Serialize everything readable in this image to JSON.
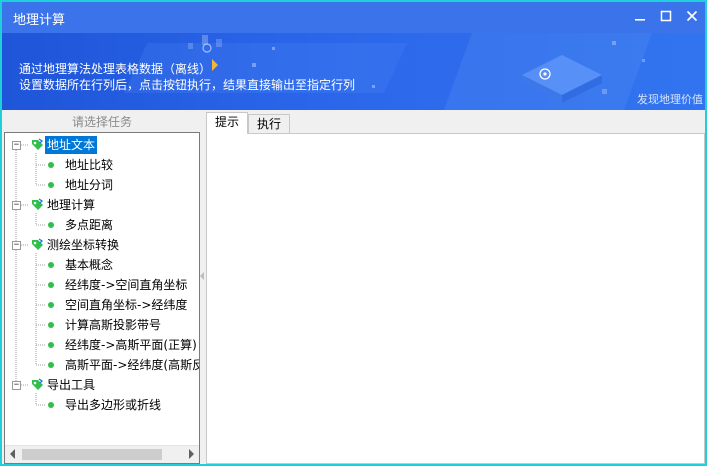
{
  "window": {
    "title": "地理计算"
  },
  "banner": {
    "line1": "通过地理算法处理表格数据（离线）",
    "line2": "设置数据所在行列后，点击按钮执行，结果直接输出至指定行列",
    "slogan": "发现地理价值"
  },
  "task_panel": {
    "header": "请选择任务",
    "groups": [
      {
        "label": "地址文本",
        "expanded": true,
        "selected": true,
        "items": [
          "地址比较",
          "地址分词"
        ]
      },
      {
        "label": "地理计算",
        "expanded": true,
        "items": [
          "多点距离"
        ]
      },
      {
        "label": "测绘坐标转换",
        "expanded": true,
        "items": [
          "基本概念",
          "经纬度->空间直角坐标",
          "空间直角坐标->经纬度",
          "计算高斯投影带号",
          "经纬度->高斯平面(正算)",
          "高斯平面->经纬度(高斯反"
        ]
      },
      {
        "label": "导出工具",
        "expanded": true,
        "items": [
          "导出多边形或折线"
        ]
      }
    ],
    "expander_symbol": "−"
  },
  "tabs": [
    {
      "label": "提示",
      "active": true
    },
    {
      "label": "执行",
      "active": false
    }
  ],
  "colors": {
    "title_bar": "#3b74ea",
    "window_border": "#1ed0d9",
    "selection": "#0078d7",
    "leaf_dot": "#2fbf4a"
  }
}
